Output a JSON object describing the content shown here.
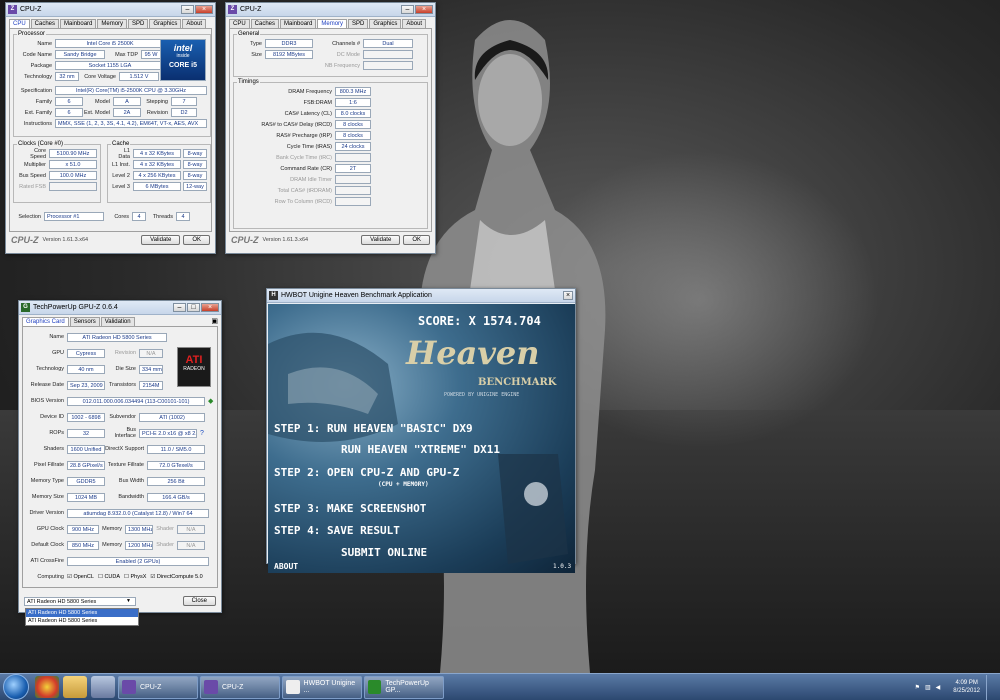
{
  "cpuz1": {
    "title": "CPU-Z",
    "tabs": [
      "CPU",
      "Caches",
      "Mainboard",
      "Memory",
      "SPD",
      "Graphics",
      "About"
    ],
    "processor_legend": "Processor",
    "name_label": "Name",
    "name": "Intel Core i5 2500K",
    "codename_label": "Code Name",
    "codename": "Sandy Bridge",
    "maxtdp_label": "Max TDP",
    "maxtdp": "95 W",
    "package_label": "Package",
    "package": "Socket 1155 LGA",
    "technology_label": "Technology",
    "technology": "32 nm",
    "corevoltage_label": "Core Voltage",
    "corevoltage": "1.512 V",
    "spec_label": "Specification",
    "spec": "Intel(R) Core(TM) i5-2500K CPU @ 3.30GHz",
    "family_label": "Family",
    "family": "6",
    "model_label": "Model",
    "model": "A",
    "stepping_label": "Stepping",
    "stepping": "7",
    "extfamily_label": "Ext. Family",
    "extfamily": "6",
    "extmodel_label": "Ext. Model",
    "extmodel": "2A",
    "revision_label": "Revision",
    "revision": "D2",
    "instr_label": "Instructions",
    "instr": "MMX, SSE (1, 2, 3, 3S, 4.1, 4.2), EM64T, VT-x, AES, AVX",
    "clocks_legend": "Clocks (Core #0)",
    "corespeed_label": "Core Speed",
    "corespeed": "5100.90 MHz",
    "multiplier_label": "Multiplier",
    "multiplier": "x 51.0",
    "busspeed_label": "Bus Speed",
    "busspeed": "100.0 MHz",
    "ratedfsb_label": "Rated FSB",
    "ratedfsb": "",
    "cache_legend": "Cache",
    "l1d_label": "L1 Data",
    "l1d": "4 x 32 KBytes",
    "l1d_way": "8-way",
    "l1i_label": "L1 Inst.",
    "l1i": "4 x 32 KBytes",
    "l1i_way": "8-way",
    "l2_label": "Level 2",
    "l2": "4 x 256 KBytes",
    "l2_way": "8-way",
    "l3_label": "Level 3",
    "l3": "6 MBytes",
    "l3_way": "12-way",
    "selection_label": "Selection",
    "selection": "Processor #1",
    "cores_label": "Cores",
    "cores": "4",
    "threads_label": "Threads",
    "threads": "4",
    "logo_line1": "intel",
    "logo_line2": "inside",
    "logo_line3": "CORE i5",
    "brand": "CPU-Z",
    "version": "Version 1.61.3.x64",
    "validate": "Validate",
    "ok": "OK"
  },
  "cpuz2": {
    "title": "CPU-Z",
    "tabs": [
      "CPU",
      "Caches",
      "Mainboard",
      "Memory",
      "SPD",
      "Graphics",
      "About"
    ],
    "general_legend": "General",
    "type_label": "Type",
    "type": "DDR3",
    "channels_label": "Channels #",
    "channels": "Dual",
    "size_label": "Size",
    "size": "8192 MBytes",
    "dcmode_label": "DC Mode",
    "dcmode": "",
    "nbfreq_label": "NB Frequency",
    "nbfreq": "",
    "timings_legend": "Timings",
    "dram_label": "DRAM Frequency",
    "dram": "800.3 MHz",
    "fsbdram_label": "FSB:DRAM",
    "fsbdram": "1:6",
    "cl_label": "CAS# Latency (CL)",
    "cl": "8.0 clocks",
    "rcd_label": "RAS# to CAS# Delay (tRCD)",
    "rcd": "8 clocks",
    "rp_label": "RAS# Precharge (tRP)",
    "rp": "8 clocks",
    "ras_label": "Cycle Time (tRAS)",
    "ras": "24 clocks",
    "rfc_label": "Bank Cycle Time (tRC)",
    "rfc": "",
    "cr_label": "Command Rate (CR)",
    "cr": "2T",
    "idle_label": "DRAM Idle Timer",
    "idle": "",
    "rdram_label": "Total CAS# (tRDRAM)",
    "rdram": "",
    "rtc_label": "Row To Column (tRCD)",
    "rtc": "",
    "brand": "CPU-Z",
    "version": "Version 1.61.3.x64",
    "validate": "Validate",
    "ok": "OK"
  },
  "gpuz": {
    "title": "TechPowerUp GPU-Z 0.6.4",
    "tabs": [
      "Graphics Card",
      "Sensors",
      "Validation"
    ],
    "name_label": "Name",
    "name": "ATI Radeon HD 5800 Series",
    "gpu_label": "GPU",
    "gpu": "Cypress",
    "revision_label": "Revision",
    "revision": "N/A",
    "technology_label": "Technology",
    "technology": "40 nm",
    "diesize_label": "Die Size",
    "diesize": "334 mm²",
    "release_label": "Release Date",
    "release": "Sep 23, 2009",
    "transistors_label": "Transistors",
    "transistors": "2154M",
    "bios_label": "BIOS Version",
    "bios": "012.011.000.006.034494 (113-C00101-101)",
    "deviceid_label": "Device ID",
    "deviceid": "1002 - 6898",
    "subvendor_label": "Subvendor",
    "subvendor": "ATI (1002)",
    "rops_label": "ROPs",
    "rops": "32",
    "busif_label": "Bus Interface",
    "busif": "PCI-E 2.0 x16 @ x8 2.0",
    "shaders_label": "Shaders",
    "shaders": "1600 Unified",
    "directx_label": "DirectX Support",
    "directx": "11.0 / SM5.0",
    "pixel_label": "Pixel Fillrate",
    "pixel": "28.8 GPixel/s",
    "texture_label": "Texture Fillrate",
    "texture": "72.0 GTexel/s",
    "memtype_label": "Memory Type",
    "memtype": "GDDR5",
    "buswidth_label": "Bus Width",
    "buswidth": "256 Bit",
    "memsize_label": "Memory Size",
    "memsize": "1024 MB",
    "bandwidth_label": "Bandwidth",
    "bandwidth": "166.4 GB/s",
    "driver_label": "Driver Version",
    "driver": "atiumdag 8.932.0.0 (Catalyst 12.8) / Win7 64",
    "gpuclock_label": "GPU Clock",
    "gpuclock": "900 MHz",
    "memory_label": "Memory",
    "memclock": "1300 MHz",
    "shader_label": "Shader",
    "shader": "N/A",
    "defclock_label": "Default Clock",
    "defclock": "850 MHz",
    "defmem": "1200 MHz",
    "defshader": "N/A",
    "crossfire_label": "ATI CrossFire",
    "crossfire": "Enabled (2 GPUs)",
    "computing_label": "Computing",
    "opencl": "OpenCL",
    "cuda": "CUDA",
    "physx": "PhysX",
    "directcompute": "DirectCompute 5.0",
    "logo_text": "ATI",
    "logo_sub": "RADEON",
    "select_value": "ATI Radeon HD 5800 Series",
    "dropdown_options": [
      "ATI Radeon HD 5800 Series",
      "ATI Radeon HD 5800 Series"
    ],
    "close": "Close"
  },
  "heaven": {
    "title": "HWBOT Unigine Heaven Benchmark Application",
    "score": "SCORE: X 1574.704",
    "logo": "Heaven",
    "logo_sub": "BENCHMARK",
    "powered": "POWERED BY UNIGINE ENGINE",
    "step1": "STEP 1:  RUN HEAVEN \"BASIC\" DX9",
    "step1b": "RUN HEAVEN \"XTREME\" DX11",
    "step2": "STEP 2:  OPEN CPU-Z   AND   GPU-Z",
    "step2b": "(CPU + MEMORY)",
    "step3": "STEP 3:  MAKE SCREENSHOT",
    "step4": "STEP 4:  SAVE RESULT",
    "step4b": "SUBMIT ONLINE",
    "about": "ABOUT",
    "version": "1.0.3"
  },
  "taskbar": {
    "tasks": [
      "CPU-Z",
      "CPU-Z",
      "HWBOT Unigine ...",
      "TechPowerUp GP..."
    ],
    "time": "4:09 PM",
    "date": "8/25/2012"
  }
}
